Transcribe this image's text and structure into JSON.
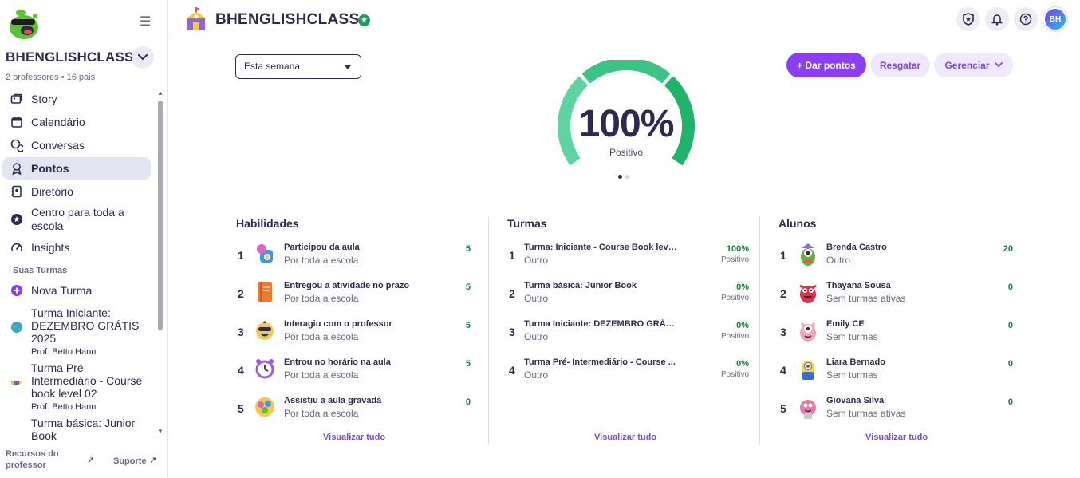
{
  "sidebar": {
    "school_name": "BHENGLISHCLASS",
    "school_meta": "2 professores • 16 pais",
    "nav": [
      {
        "label": "Story",
        "icon": "story-icon"
      },
      {
        "label": "Calendário",
        "icon": "calendar-icon"
      },
      {
        "label": "Conversas",
        "icon": "chat-icon"
      },
      {
        "label": "Pontos",
        "icon": "award-icon",
        "active": true
      },
      {
        "label": "Diretório",
        "icon": "directory-icon"
      },
      {
        "label": "Centro para toda a escola",
        "icon": "star-circle-icon"
      },
      {
        "label": "Insights",
        "icon": "gauge-icon"
      }
    ],
    "section_label": "Suas Turmas",
    "new_class": "Nova Turma",
    "classes": [
      {
        "title": "Turma Iniciante: DEZEMBRO GRÁTIS 2025",
        "prof": "Prof. Betto Hann"
      },
      {
        "title": "Turma Pré-Intermediário - Course book level 02",
        "prof": "Prof. Betto Hann"
      },
      {
        "title": "Turma básica: Junior Book",
        "prof": ""
      }
    ],
    "footer": {
      "resources": "Recursos do professor",
      "support": "Suporte"
    }
  },
  "header": {
    "title": "BHENGLISHCLASS",
    "avatar_initials": "BH"
  },
  "controls": {
    "period": "Esta semana",
    "give_points": "+ Dar pontos",
    "redeem": "Resgatar",
    "manage": "Gerenciar"
  },
  "gauge": {
    "value_text": "100%",
    "value": 1.0,
    "label": "Positivo",
    "colors": [
      "#5fd3a2",
      "#3cc487",
      "#1fb36b"
    ]
  },
  "panels": {
    "skills": {
      "title": "Habilidades",
      "view_all": "Visualizar tudo",
      "rows": [
        {
          "rank": "1",
          "title": "Participou da aula",
          "sub": "Por toda a escola",
          "value": "5"
        },
        {
          "rank": "2",
          "title": "Entregou a atividade no prazo",
          "sub": "Por toda a escola",
          "value": "5"
        },
        {
          "rank": "3",
          "title": "Interagiu com o professor",
          "sub": "Por toda a escola",
          "value": "5"
        },
        {
          "rank": "4",
          "title": "Entrou no horário na aula",
          "sub": "Por toda a escola",
          "value": "5"
        },
        {
          "rank": "5",
          "title": "Assistiu a aula gravada",
          "sub": "Por toda a escola",
          "value": "0"
        }
      ]
    },
    "classes": {
      "title": "Turmas",
      "view_all": "Visualizar tudo",
      "rows": [
        {
          "rank": "1",
          "title": "Turma: Iniciante - Course Book leve...",
          "sub": "Outro",
          "value": "100%",
          "value_sub": "Positivo"
        },
        {
          "rank": "2",
          "title": "Turma básica: Junior Book",
          "sub": "Outro",
          "value": "0%",
          "value_sub": "Positivo"
        },
        {
          "rank": "3",
          "title": "Turma Iniciante: DEZEMBRO GRÁTI...",
          "sub": "Outro",
          "value": "0%",
          "value_sub": "Positivo"
        },
        {
          "rank": "4",
          "title": "Turma Pré- Intermediário - Course ...",
          "sub": "Outro",
          "value": "0%",
          "value_sub": "Positivo"
        }
      ]
    },
    "students": {
      "title": "Alunos",
      "view_all": "Visualizar tudo",
      "rows": [
        {
          "rank": "1",
          "title": "Brenda Castro",
          "sub": "Outro",
          "value": "20"
        },
        {
          "rank": "2",
          "title": "Thayana Sousa",
          "sub": "Sem turmas ativas",
          "value": "0"
        },
        {
          "rank": "3",
          "title": "Emily CE",
          "sub": "Sem turmas",
          "value": "0"
        },
        {
          "rank": "4",
          "title": "Liara Bernado",
          "sub": "Sem turmas",
          "value": "0"
        },
        {
          "rank": "5",
          "title": "Giovana Silva",
          "sub": "Sem turmas ativas",
          "value": "0"
        }
      ]
    }
  }
}
